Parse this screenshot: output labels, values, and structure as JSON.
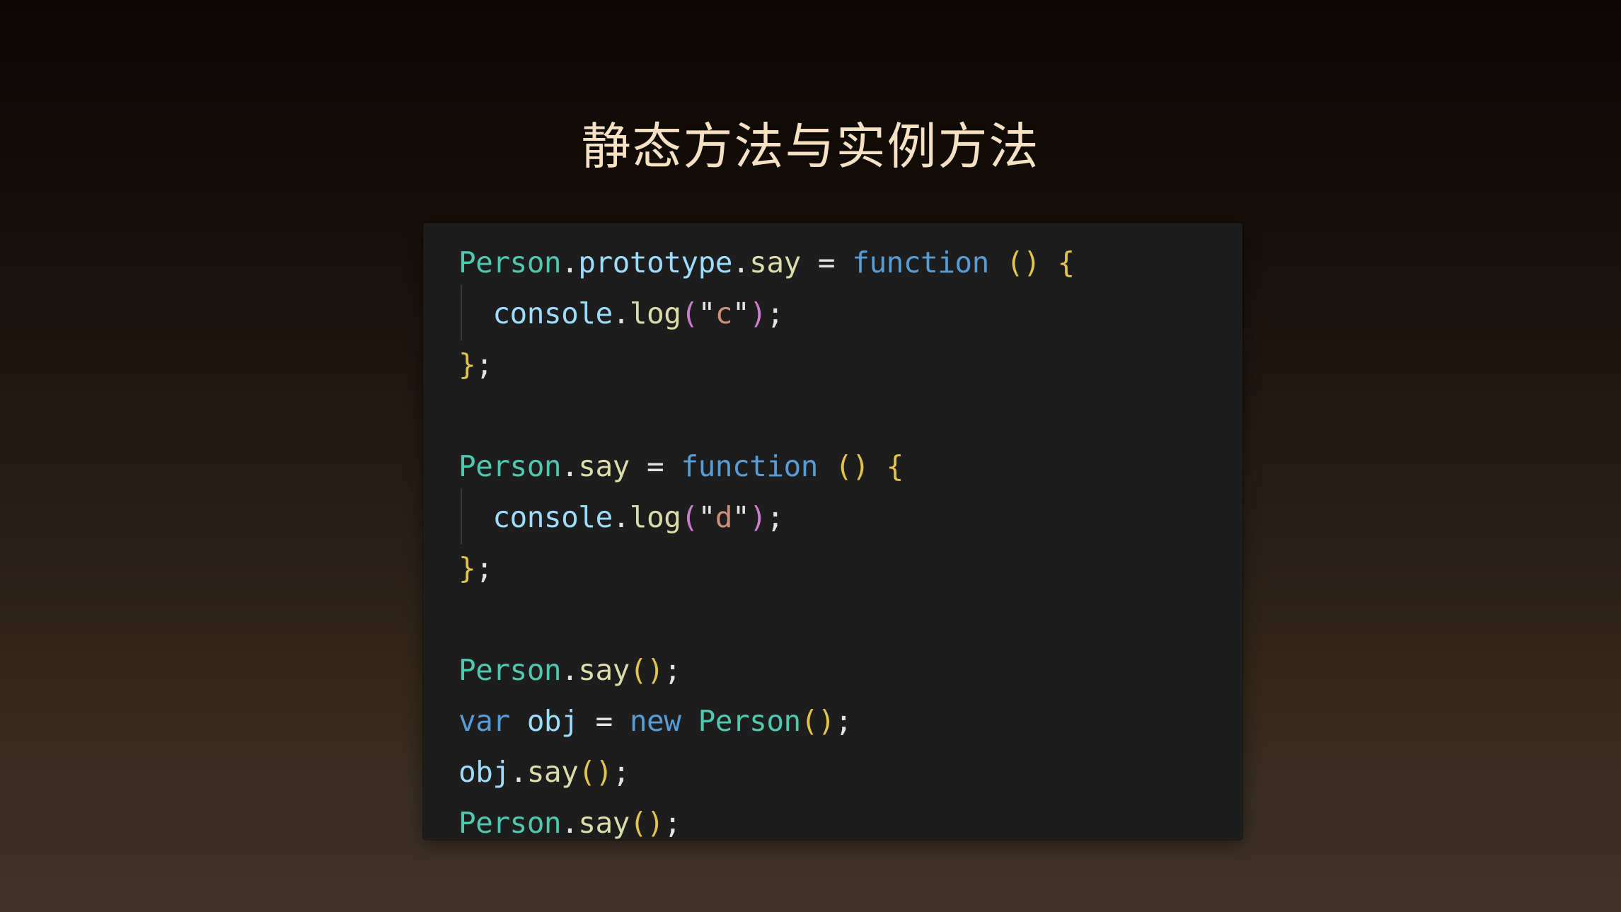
{
  "slide": {
    "title": "静态方法与实例方法",
    "title_color": "#F6E2C3",
    "background_top_color": "#0C0705",
    "background_bottom_color": "#3F3329"
  },
  "code_card": {
    "background_color": "#1D1D1D",
    "language": "javascript",
    "theme_colors": {
      "class": "#4EC9B0",
      "property": "#9CDCFE",
      "function": "#DCDCAA",
      "keyword": "#569CD6",
      "string": "#CE9178",
      "paren_yellow": "#E2C44A",
      "paren_magenta": "#CF7BD4",
      "plain": "#E3E3E3"
    },
    "plain_text": "Person.prototype.say = function () {\n  console.log(\"c\");\n};\n\nPerson.say = function () {\n  console.log(\"d\");\n};\n\nPerson.say();\nvar obj = new Person();\nobj.say();\nPerson.say();",
    "lines": [
      {
        "indented": false,
        "tokens": [
          {
            "text": "Person",
            "kind": "class"
          },
          {
            "text": ".",
            "kind": "plain"
          },
          {
            "text": "prototype",
            "kind": "property"
          },
          {
            "text": ".",
            "kind": "plain"
          },
          {
            "text": "say",
            "kind": "function"
          },
          {
            "text": " = ",
            "kind": "plain"
          },
          {
            "text": "function",
            "kind": "keyword"
          },
          {
            "text": " ",
            "kind": "plain"
          },
          {
            "text": "()",
            "kind": "paren_yellow"
          },
          {
            "text": " ",
            "kind": "plain"
          },
          {
            "text": "{",
            "kind": "paren_yellow"
          }
        ]
      },
      {
        "indented": true,
        "tokens": [
          {
            "text": "  ",
            "kind": "plain"
          },
          {
            "text": "console",
            "kind": "property"
          },
          {
            "text": ".",
            "kind": "plain"
          },
          {
            "text": "log",
            "kind": "function"
          },
          {
            "text": "(",
            "kind": "paren_magenta"
          },
          {
            "text": "\"",
            "kind": "plain"
          },
          {
            "text": "c",
            "kind": "string"
          },
          {
            "text": "\"",
            "kind": "plain"
          },
          {
            "text": ")",
            "kind": "paren_magenta"
          },
          {
            "text": ";",
            "kind": "plain"
          }
        ]
      },
      {
        "indented": false,
        "tokens": [
          {
            "text": "}",
            "kind": "paren_yellow"
          },
          {
            "text": ";",
            "kind": "plain"
          }
        ]
      },
      {
        "indented": false,
        "tokens": []
      },
      {
        "indented": false,
        "tokens": [
          {
            "text": "Person",
            "kind": "class"
          },
          {
            "text": ".",
            "kind": "plain"
          },
          {
            "text": "say",
            "kind": "function"
          },
          {
            "text": " = ",
            "kind": "plain"
          },
          {
            "text": "function",
            "kind": "keyword"
          },
          {
            "text": " ",
            "kind": "plain"
          },
          {
            "text": "()",
            "kind": "paren_yellow"
          },
          {
            "text": " ",
            "kind": "plain"
          },
          {
            "text": "{",
            "kind": "paren_yellow"
          }
        ]
      },
      {
        "indented": true,
        "tokens": [
          {
            "text": "  ",
            "kind": "plain"
          },
          {
            "text": "console",
            "kind": "property"
          },
          {
            "text": ".",
            "kind": "plain"
          },
          {
            "text": "log",
            "kind": "function"
          },
          {
            "text": "(",
            "kind": "paren_magenta"
          },
          {
            "text": "\"",
            "kind": "plain"
          },
          {
            "text": "d",
            "kind": "string"
          },
          {
            "text": "\"",
            "kind": "plain"
          },
          {
            "text": ")",
            "kind": "paren_magenta"
          },
          {
            "text": ";",
            "kind": "plain"
          }
        ]
      },
      {
        "indented": false,
        "tokens": [
          {
            "text": "}",
            "kind": "paren_yellow"
          },
          {
            "text": ";",
            "kind": "plain"
          }
        ]
      },
      {
        "indented": false,
        "tokens": []
      },
      {
        "indented": false,
        "tokens": [
          {
            "text": "Person",
            "kind": "class"
          },
          {
            "text": ".",
            "kind": "plain"
          },
          {
            "text": "say",
            "kind": "function"
          },
          {
            "text": "()",
            "kind": "paren_yellow"
          },
          {
            "text": ";",
            "kind": "plain"
          }
        ]
      },
      {
        "indented": false,
        "tokens": [
          {
            "text": "var",
            "kind": "keyword"
          },
          {
            "text": " ",
            "kind": "plain"
          },
          {
            "text": "obj",
            "kind": "property"
          },
          {
            "text": " = ",
            "kind": "plain"
          },
          {
            "text": "new",
            "kind": "keyword"
          },
          {
            "text": " ",
            "kind": "plain"
          },
          {
            "text": "Person",
            "kind": "class"
          },
          {
            "text": "()",
            "kind": "paren_yellow"
          },
          {
            "text": ";",
            "kind": "plain"
          }
        ]
      },
      {
        "indented": false,
        "tokens": [
          {
            "text": "obj",
            "kind": "property"
          },
          {
            "text": ".",
            "kind": "plain"
          },
          {
            "text": "say",
            "kind": "function"
          },
          {
            "text": "()",
            "kind": "paren_yellow"
          },
          {
            "text": ";",
            "kind": "plain"
          }
        ]
      },
      {
        "indented": false,
        "tokens": [
          {
            "text": "Person",
            "kind": "class"
          },
          {
            "text": ".",
            "kind": "plain"
          },
          {
            "text": "say",
            "kind": "function"
          },
          {
            "text": "()",
            "kind": "paren_yellow"
          },
          {
            "text": ";",
            "kind": "plain"
          }
        ]
      }
    ]
  }
}
